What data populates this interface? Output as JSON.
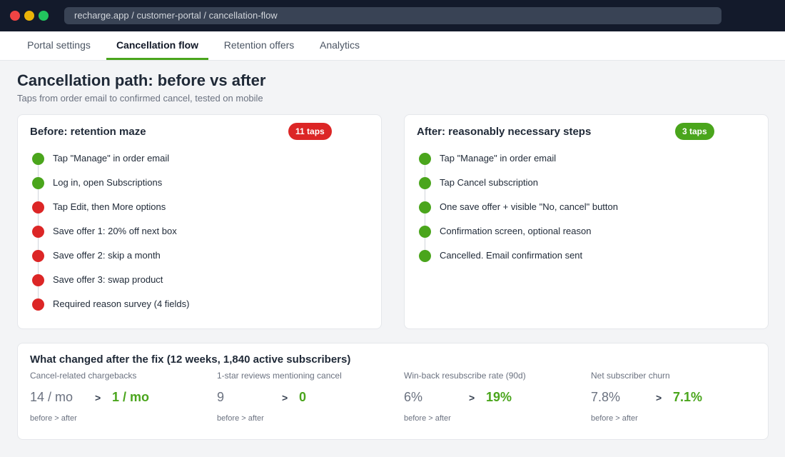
{
  "window": {
    "url": "recharge.app / customer-portal / cancellation-flow"
  },
  "tabs": [
    {
      "label": "Portal settings",
      "active": false
    },
    {
      "label": "Cancellation flow",
      "active": true
    },
    {
      "label": "Retention offers",
      "active": false
    },
    {
      "label": "Analytics",
      "active": false
    }
  ],
  "header": {
    "title": "Cancellation path: before vs after",
    "subtitle": "Taps from order email to confirmed cancel, tested on mobile"
  },
  "before": {
    "title": "Before: retention maze",
    "badge": "11 taps",
    "steps": [
      {
        "text": "Tap \"Manage\" in order email",
        "status": "green"
      },
      {
        "text": "Log in, open Subscriptions",
        "status": "green"
      },
      {
        "text": "Tap Edit, then More options",
        "status": "red"
      },
      {
        "text": "Save offer 1: 20% off next box",
        "status": "red"
      },
      {
        "text": "Save offer 2: skip a month",
        "status": "red"
      },
      {
        "text": "Save offer 3: swap product",
        "status": "red"
      },
      {
        "text": "Required reason survey (4 fields)",
        "status": "red"
      }
    ]
  },
  "after": {
    "title": "After: reasonably necessary steps",
    "badge": "3 taps",
    "steps": [
      {
        "text": "Tap \"Manage\" in order email",
        "status": "green"
      },
      {
        "text": "Tap Cancel subscription",
        "status": "green"
      },
      {
        "text": "One save offer + visible \"No, cancel\" button",
        "status": "green"
      },
      {
        "text": "Confirmation screen, optional reason",
        "status": "green"
      },
      {
        "text": "Cancelled. Email confirmation sent",
        "status": "green"
      }
    ]
  },
  "metrics": {
    "title": "What changed after the fix (12 weeks, 1,840 active subscribers)",
    "arrow": ">",
    "legend": "before  >  after",
    "items": [
      {
        "label": "Cancel-related chargebacks",
        "before": "14 / mo",
        "after": "1 / mo"
      },
      {
        "label": "1-star reviews mentioning cancel",
        "before": "9",
        "after": "0"
      },
      {
        "label": "Win-back resubscribe rate (90d)",
        "before": "6%",
        "after": "19%"
      },
      {
        "label": "Net subscriber churn",
        "before": "7.8%",
        "after": "7.1%"
      }
    ]
  },
  "colors": {
    "accent_green": "#4aa51c",
    "alert_red": "#dc2626",
    "titlebar": "#131a2b"
  }
}
